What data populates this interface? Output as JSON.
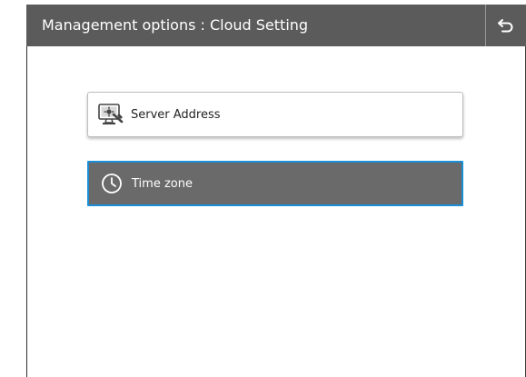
{
  "header": {
    "title": "Management options : Cloud Setting",
    "back_icon": "return-arrow-icon"
  },
  "options": [
    {
      "label": "Server Address",
      "icon": "server-monitor-icon",
      "selected": false
    },
    {
      "label": "Time zone",
      "icon": "clock-icon",
      "selected": true
    }
  ],
  "colors": {
    "titlebar": "#5b5b5b",
    "selected_fill": "#6a6a6a",
    "selected_border": "#1a8fd6",
    "background": "#ffffff"
  }
}
